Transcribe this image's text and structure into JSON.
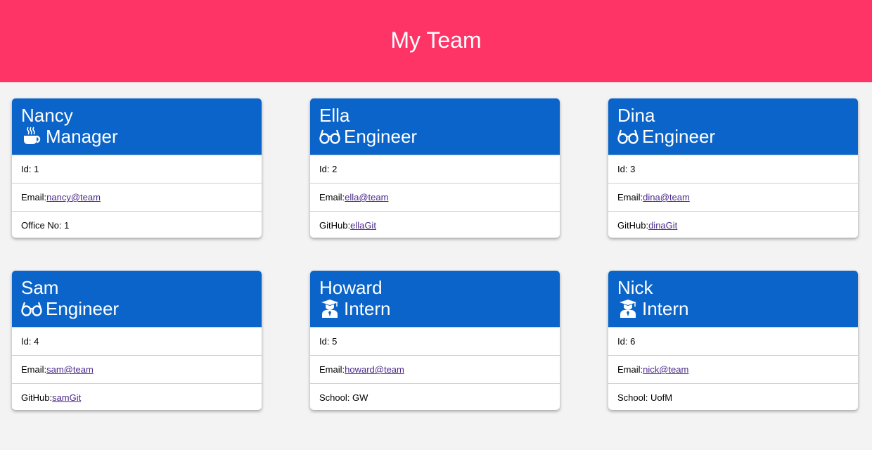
{
  "page": {
    "title": "My Team"
  },
  "colors": {
    "header_bg": "#ff3466",
    "card_head_bg": "#0a64c9",
    "page_bg": "#f3f3f3",
    "link": "#4b2a8a"
  },
  "employees": [
    {
      "name": "Nancy",
      "role": "Manager",
      "icon": "coffee-icon",
      "id_label": "Id: 1",
      "email_label": "Email:",
      "email": " nancy@team",
      "extra_label": "Office No: 1",
      "extra_link": ""
    },
    {
      "name": "Ella",
      "role": "Engineer",
      "icon": "glasses-icon",
      "id_label": "Id: 2",
      "email_label": "Email:",
      "email": " ella@team",
      "extra_label": "GitHub:",
      "extra_link": " ellaGit"
    },
    {
      "name": "Dina",
      "role": "Engineer",
      "icon": "glasses-icon",
      "id_label": "Id: 3",
      "email_label": "Email:",
      "email": " dina@team",
      "extra_label": "GitHub:",
      "extra_link": " dinaGit"
    },
    {
      "name": "Sam",
      "role": "Engineer",
      "icon": "glasses-icon",
      "id_label": "Id: 4",
      "email_label": "Email:",
      "email": " sam@team",
      "extra_label": "GitHub:",
      "extra_link": " samGit"
    },
    {
      "name": "Howard",
      "role": "Intern",
      "icon": "graduate-icon",
      "id_label": "Id: 5",
      "email_label": "Email:",
      "email": " howard@team",
      "extra_label": "School: GW",
      "extra_link": ""
    },
    {
      "name": "Nick",
      "role": "Intern",
      "icon": "graduate-icon",
      "id_label": "Id: 6",
      "email_label": "Email:",
      "email": " nick@team",
      "extra_label": "School: UofM",
      "extra_link": ""
    }
  ]
}
